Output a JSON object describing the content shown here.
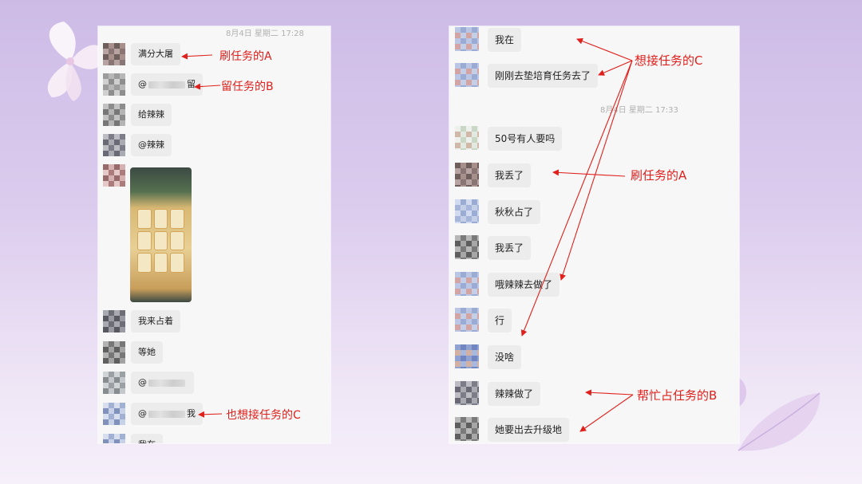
{
  "left_panel": {
    "timestamp": "8月4日 星期二 17:28",
    "messages": [
      {
        "text": "满分大屠"
      },
      {
        "text_before": "@",
        "text_after": "留"
      },
      {
        "text": "给辣辣"
      },
      {
        "text": "@辣辣"
      },
      {
        "text": "我来占着"
      },
      {
        "text": "等她"
      },
      {
        "text_before": "@"
      },
      {
        "text_before": "@",
        "text_after": "我"
      },
      {
        "text": "我在"
      }
    ]
  },
  "right_panel": {
    "timestamp": "8月4日 星期二 17:33",
    "messages": [
      {
        "text": "我在"
      },
      {
        "text": "刚刚去垫培育任务去了"
      },
      {
        "text": "50号有人要吗"
      },
      {
        "text": "我丢了"
      },
      {
        "text": "秋秋占了"
      },
      {
        "text": "我丢了"
      },
      {
        "text": "哦辣辣去做了"
      },
      {
        "text": "行"
      },
      {
        "text": "没啥"
      },
      {
        "text": "辣辣做了"
      },
      {
        "text": "她要出去升级地"
      }
    ]
  },
  "annotations": {
    "left_a": "刷任务的A",
    "left_b": "留任务的B",
    "left_c": "也想接任务的C",
    "right_c": "想接任务的C",
    "right_a": "刷任务的A",
    "right_b": "帮忙占任务的B"
  },
  "colors": {
    "annotation": "#e0201c",
    "bubble": "#ececec",
    "panel": "#f7f7f7"
  },
  "icons": [
    "blurred-avatar",
    "game-screenshot-thumbnail",
    "petal-decoration"
  ]
}
